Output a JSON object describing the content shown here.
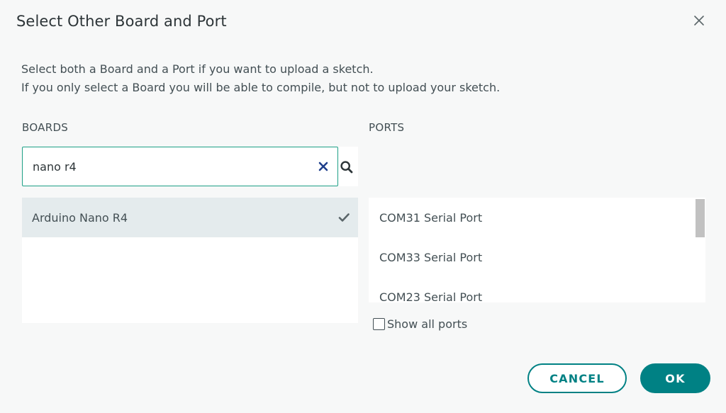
{
  "dialog": {
    "title": "Select Other Board and Port",
    "close_icon": "close-icon"
  },
  "description": {
    "line1": "Select both a Board and a Port if you want to upload a sketch.",
    "line2": "If you only select a Board you will be able to compile, but not to upload your sketch."
  },
  "boards": {
    "label": "BOARDS",
    "search_value": "nano r4",
    "clear_icon": "clear-icon",
    "search_icon": "search-icon",
    "items": [
      {
        "label": "Arduino Nano R4",
        "selected": true,
        "icon": "checkmark-icon"
      }
    ]
  },
  "ports": {
    "label": "PORTS",
    "items": [
      {
        "label": "COM31 Serial Port"
      },
      {
        "label": "COM33 Serial Port"
      },
      {
        "label": "COM23 Serial Port"
      }
    ],
    "show_all_label": "Show all ports",
    "show_all_checked": false
  },
  "actions": {
    "cancel_label": "CANCEL",
    "ok_label": "OK"
  },
  "colors": {
    "accent": "#008184",
    "focus_border": "#1da086",
    "selected_row": "#e4ebed",
    "clear_icon": "#1f3f8c"
  }
}
